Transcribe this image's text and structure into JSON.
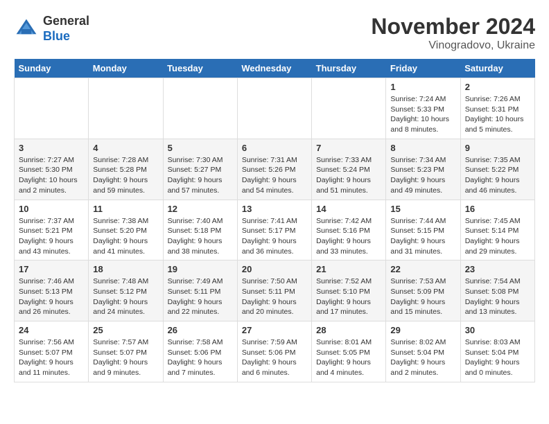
{
  "header": {
    "logo_line1": "General",
    "logo_line2": "Blue",
    "title": "November 2024",
    "subtitle": "Vinogradovo, Ukraine"
  },
  "weekdays": [
    "Sunday",
    "Monday",
    "Tuesday",
    "Wednesday",
    "Thursday",
    "Friday",
    "Saturday"
  ],
  "weeks": [
    [
      {
        "day": "",
        "info": ""
      },
      {
        "day": "",
        "info": ""
      },
      {
        "day": "",
        "info": ""
      },
      {
        "day": "",
        "info": ""
      },
      {
        "day": "",
        "info": ""
      },
      {
        "day": "1",
        "info": "Sunrise: 7:24 AM\nSunset: 5:33 PM\nDaylight: 10 hours\nand 8 minutes."
      },
      {
        "day": "2",
        "info": "Sunrise: 7:26 AM\nSunset: 5:31 PM\nDaylight: 10 hours\nand 5 minutes."
      }
    ],
    [
      {
        "day": "3",
        "info": "Sunrise: 7:27 AM\nSunset: 5:30 PM\nDaylight: 10 hours\nand 2 minutes."
      },
      {
        "day": "4",
        "info": "Sunrise: 7:28 AM\nSunset: 5:28 PM\nDaylight: 9 hours\nand 59 minutes."
      },
      {
        "day": "5",
        "info": "Sunrise: 7:30 AM\nSunset: 5:27 PM\nDaylight: 9 hours\nand 57 minutes."
      },
      {
        "day": "6",
        "info": "Sunrise: 7:31 AM\nSunset: 5:26 PM\nDaylight: 9 hours\nand 54 minutes."
      },
      {
        "day": "7",
        "info": "Sunrise: 7:33 AM\nSunset: 5:24 PM\nDaylight: 9 hours\nand 51 minutes."
      },
      {
        "day": "8",
        "info": "Sunrise: 7:34 AM\nSunset: 5:23 PM\nDaylight: 9 hours\nand 49 minutes."
      },
      {
        "day": "9",
        "info": "Sunrise: 7:35 AM\nSunset: 5:22 PM\nDaylight: 9 hours\nand 46 minutes."
      }
    ],
    [
      {
        "day": "10",
        "info": "Sunrise: 7:37 AM\nSunset: 5:21 PM\nDaylight: 9 hours\nand 43 minutes."
      },
      {
        "day": "11",
        "info": "Sunrise: 7:38 AM\nSunset: 5:20 PM\nDaylight: 9 hours\nand 41 minutes."
      },
      {
        "day": "12",
        "info": "Sunrise: 7:40 AM\nSunset: 5:18 PM\nDaylight: 9 hours\nand 38 minutes."
      },
      {
        "day": "13",
        "info": "Sunrise: 7:41 AM\nSunset: 5:17 PM\nDaylight: 9 hours\nand 36 minutes."
      },
      {
        "day": "14",
        "info": "Sunrise: 7:42 AM\nSunset: 5:16 PM\nDaylight: 9 hours\nand 33 minutes."
      },
      {
        "day": "15",
        "info": "Sunrise: 7:44 AM\nSunset: 5:15 PM\nDaylight: 9 hours\nand 31 minutes."
      },
      {
        "day": "16",
        "info": "Sunrise: 7:45 AM\nSunset: 5:14 PM\nDaylight: 9 hours\nand 29 minutes."
      }
    ],
    [
      {
        "day": "17",
        "info": "Sunrise: 7:46 AM\nSunset: 5:13 PM\nDaylight: 9 hours\nand 26 minutes."
      },
      {
        "day": "18",
        "info": "Sunrise: 7:48 AM\nSunset: 5:12 PM\nDaylight: 9 hours\nand 24 minutes."
      },
      {
        "day": "19",
        "info": "Sunrise: 7:49 AM\nSunset: 5:11 PM\nDaylight: 9 hours\nand 22 minutes."
      },
      {
        "day": "20",
        "info": "Sunrise: 7:50 AM\nSunset: 5:11 PM\nDaylight: 9 hours\nand 20 minutes."
      },
      {
        "day": "21",
        "info": "Sunrise: 7:52 AM\nSunset: 5:10 PM\nDaylight: 9 hours\nand 17 minutes."
      },
      {
        "day": "22",
        "info": "Sunrise: 7:53 AM\nSunset: 5:09 PM\nDaylight: 9 hours\nand 15 minutes."
      },
      {
        "day": "23",
        "info": "Sunrise: 7:54 AM\nSunset: 5:08 PM\nDaylight: 9 hours\nand 13 minutes."
      }
    ],
    [
      {
        "day": "24",
        "info": "Sunrise: 7:56 AM\nSunset: 5:07 PM\nDaylight: 9 hours\nand 11 minutes."
      },
      {
        "day": "25",
        "info": "Sunrise: 7:57 AM\nSunset: 5:07 PM\nDaylight: 9 hours\nand 9 minutes."
      },
      {
        "day": "26",
        "info": "Sunrise: 7:58 AM\nSunset: 5:06 PM\nDaylight: 9 hours\nand 7 minutes."
      },
      {
        "day": "27",
        "info": "Sunrise: 7:59 AM\nSunset: 5:06 PM\nDaylight: 9 hours\nand 6 minutes."
      },
      {
        "day": "28",
        "info": "Sunrise: 8:01 AM\nSunset: 5:05 PM\nDaylight: 9 hours\nand 4 minutes."
      },
      {
        "day": "29",
        "info": "Sunrise: 8:02 AM\nSunset: 5:04 PM\nDaylight: 9 hours\nand 2 minutes."
      },
      {
        "day": "30",
        "info": "Sunrise: 8:03 AM\nSunset: 5:04 PM\nDaylight: 9 hours\nand 0 minutes."
      }
    ]
  ]
}
